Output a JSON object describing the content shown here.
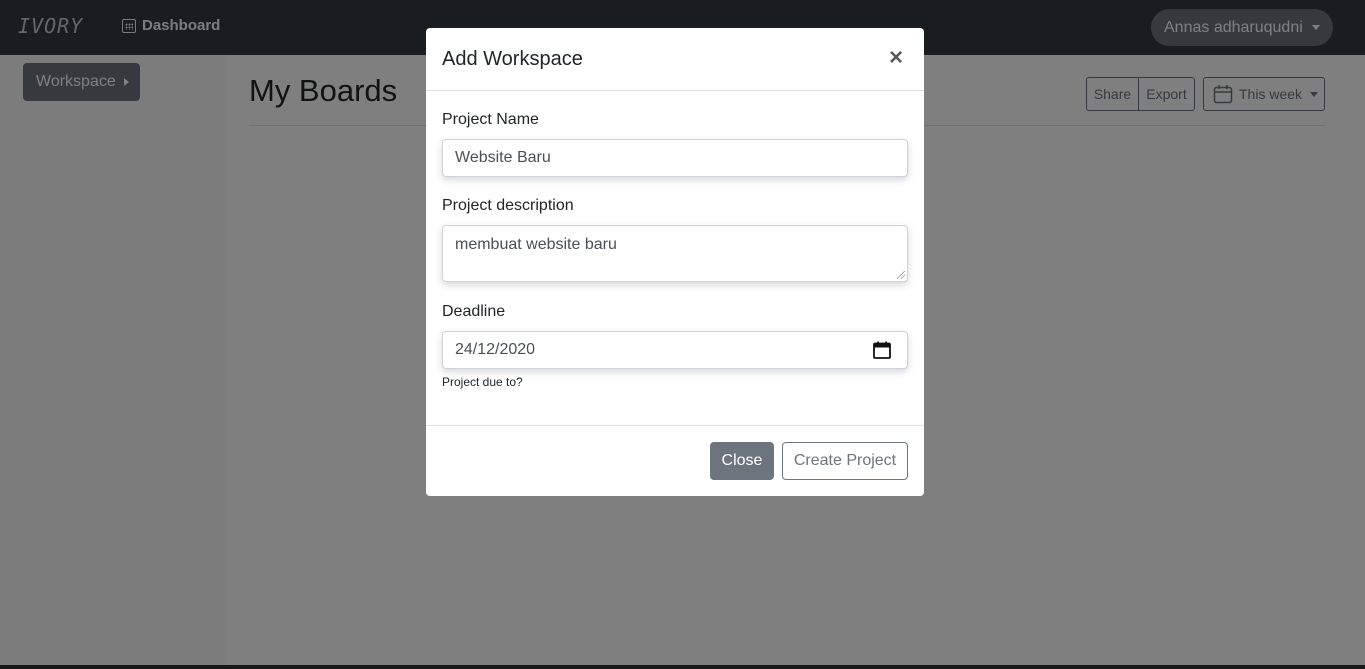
{
  "navbar": {
    "brand": "IVORY",
    "dashboard_label": "Dashboard",
    "user_name": "Annas adharuqudni"
  },
  "sidebar": {
    "workspace_label": "Workspace"
  },
  "main": {
    "title": "My Boards",
    "share_label": "Share",
    "export_label": "Export",
    "period_label": "This week"
  },
  "modal": {
    "title": "Add Workspace",
    "close_icon": "×",
    "project_name_label": "Project Name",
    "project_name_value": "Website Baru",
    "project_description_label": "Project description",
    "project_description_value": "membuat website baru",
    "deadline_label": "Deadline",
    "deadline_value": "24/12/2020",
    "deadline_help": "Project due to?",
    "close_button": "Close",
    "create_button": "Create Project"
  },
  "colors": {
    "navbar": "#343a40",
    "secondary": "#6c757d",
    "backdrop": "rgba(0,0,0,0.5)"
  }
}
